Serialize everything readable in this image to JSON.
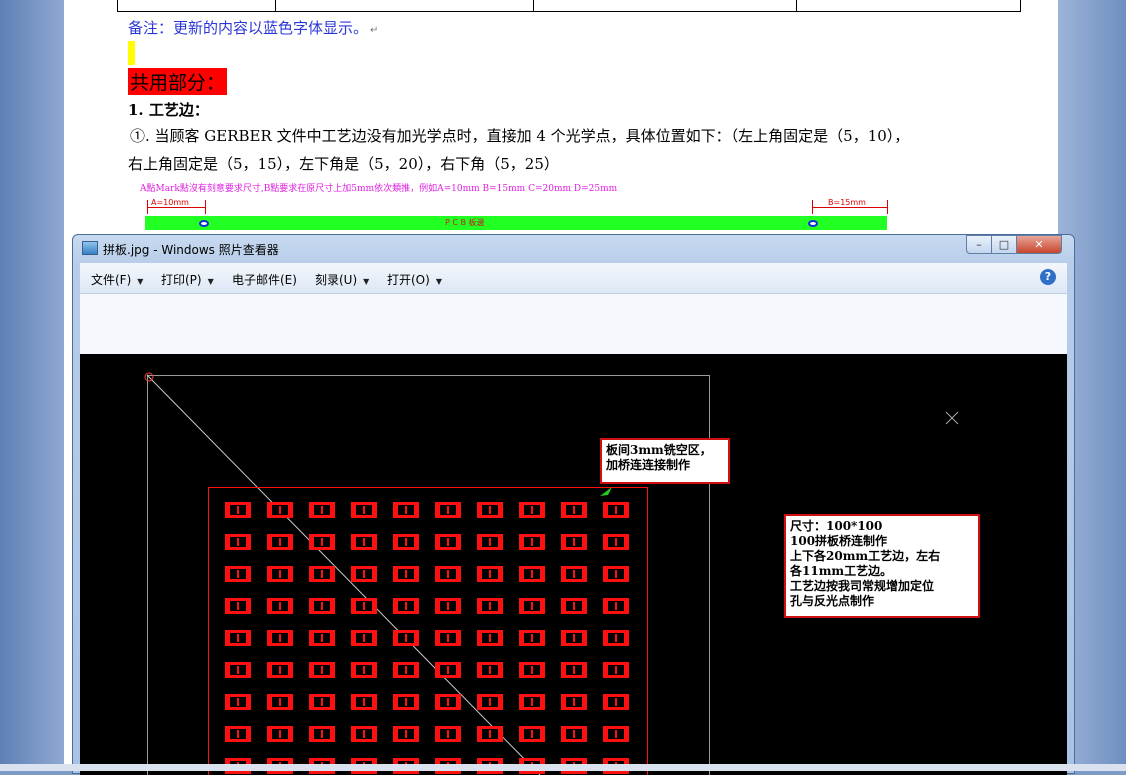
{
  "document": {
    "note": "备注：更新的内容以蓝色字体显示。",
    "para_mark": "↵",
    "shared_heading": "共用部分：",
    "section1_heading": "1. 工艺边：",
    "para1": "①. 当顾客 GERBER 文件中工艺边没有加光学点时，直接加 4 个光学点，具体位置如下：（左上角固定是（5，10），",
    "para2": "右上角固定是（5，15），左下角是（5，20），右下角（5，25）",
    "diagram_caption": "A點Mark點沒有刻意要求尺寸,B點要求在原尺寸上加5mm依次類推，例如A=10mm B=15mm C=20mm D=25mm",
    "dim_a": "A=10mm",
    "dim_b": "B=15mm",
    "pcb_bar_label": "P C B 板邊"
  },
  "viewer": {
    "title": "拼板.jpg - Windows 照片查看器",
    "min_label": "–",
    "max_label": "□",
    "close_label": "✕",
    "help_label": "?",
    "menu": [
      {
        "label": "文件(F)"
      },
      {
        "label": "打印(P)"
      },
      {
        "label": "电子邮件(E)"
      },
      {
        "label": "刻录(U)"
      },
      {
        "label": "打开(O)"
      }
    ],
    "dropdown_arrow": "▼",
    "callout_1": [
      "板间3mm铣空区，",
      "加桥连连接制作"
    ],
    "callout_2": [
      "尺寸：100*100",
      "100拼板桥连制作",
      "上下各20mm工艺边，左右",
      "各11mm工艺边。",
      "工艺边按我司常规增加定位",
      "孔与反光点制作"
    ]
  },
  "colors": {
    "note_blue": "#2b36d8",
    "highlight_red": "#ff0000",
    "highlight_yellow": "#ffff00",
    "pcb_green": "#22ff22",
    "pad_red": "#ff1010"
  }
}
